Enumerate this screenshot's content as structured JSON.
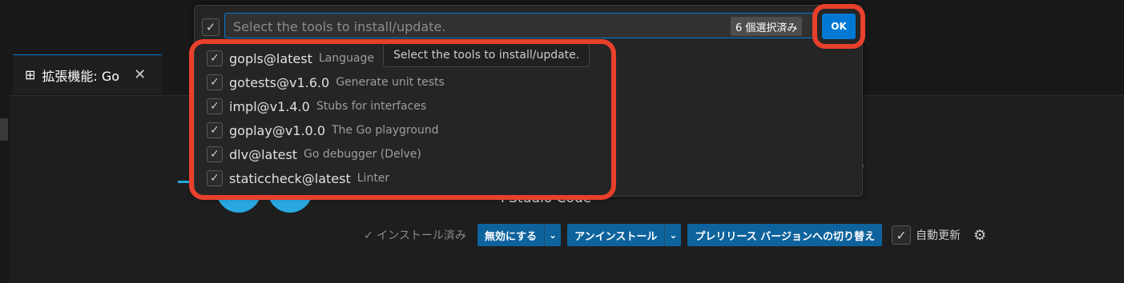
{
  "quick_pick": {
    "placeholder": "Select the tools to install/update.",
    "selected_count": "6 個選択済み",
    "ok_label": "OK",
    "tooltip": "Select the tools to install/update.",
    "items": [
      {
        "name": "gopls@latest",
        "detail": "Language",
        "checked": true
      },
      {
        "name": "gotests@v1.6.0",
        "detail": "Generate unit tests",
        "checked": true
      },
      {
        "name": "impl@v1.4.0",
        "detail": "Stubs for interfaces",
        "checked": true
      },
      {
        "name": "goplay@v1.0.0",
        "detail": "The Go playground",
        "checked": true
      },
      {
        "name": "dlv@latest",
        "detail": "Go debugger (Delve)",
        "checked": true
      },
      {
        "name": "staticcheck@latest",
        "detail": "Linter",
        "checked": true
      }
    ]
  },
  "tab": {
    "title": "拡張機能: Go"
  },
  "extension": {
    "paren_fragment": ")",
    "description_fragment": "l Studio Code",
    "installed_label": "✓ インストール済み",
    "disable_label": "無効にする",
    "uninstall_label": "アンインストール",
    "prerelease_label": "プレリリース バージョンへの切り替え",
    "auto_update_label": "自動更新"
  },
  "icons": {
    "check": "✓",
    "close": "✕",
    "chevron_down": "⌄",
    "gear": "⚙",
    "extensions": "⊞"
  },
  "colors": {
    "accent": "#0078d4",
    "highlight": "#e8402b",
    "button": "#0e639c"
  }
}
